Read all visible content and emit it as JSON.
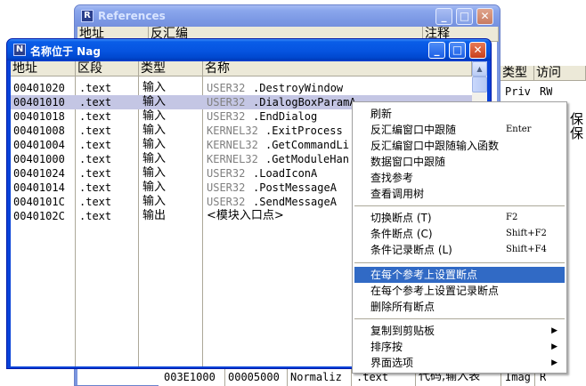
{
  "ref_window": {
    "title": "References",
    "icon_letter": "R",
    "header_partial": [
      "地址",
      "反汇编",
      "注释"
    ],
    "right_headers": [
      "类型",
      "访问"
    ],
    "right_rows": [
      [
        "Priv",
        "RW"
      ],
      [
        "Priv",
        "RW"
      ]
    ],
    "side_text": [
      "保",
      "保"
    ],
    "bottom_row": [
      "003E1000",
      "00005000",
      "Normaliz",
      ".text",
      "代码,输入表",
      "Imag",
      "R"
    ]
  },
  "nag_window": {
    "title": "名称位于 Nag",
    "icon_letter": "N",
    "columns": [
      "地址",
      "区段",
      "类型",
      "名称"
    ],
    "rows": [
      {
        "addr": "00401020",
        "section": ".text",
        "type": "输入",
        "module": "USER32",
        "func": ".DestroyWindow"
      },
      {
        "addr": "00401010",
        "section": ".text",
        "type": "输入",
        "module": "USER32",
        "func": ".DialogBoxParamA"
      },
      {
        "addr": "00401018",
        "section": ".text",
        "type": "输入",
        "module": "USER32",
        "func": ".EndDialog"
      },
      {
        "addr": "00401008",
        "section": ".text",
        "type": "输入",
        "module": "KERNEL32",
        "func": ".ExitProcess"
      },
      {
        "addr": "00401004",
        "section": ".text",
        "type": "输入",
        "module": "KERNEL32",
        "func": ".GetCommandLi"
      },
      {
        "addr": "00401000",
        "section": ".text",
        "type": "输入",
        "module": "KERNEL32",
        "func": ".GetModuleHan"
      },
      {
        "addr": "00401024",
        "section": ".text",
        "type": "输入",
        "module": "USER32",
        "func": ".LoadIconA"
      },
      {
        "addr": "00401014",
        "section": ".text",
        "type": "输入",
        "module": "USER32",
        "func": ".PostMessageA"
      },
      {
        "addr": "0040101C",
        "section": ".text",
        "type": "输入",
        "module": "USER32",
        "func": ".SendMessageA"
      },
      {
        "addr": "0040102C",
        "section": ".text",
        "type": "输出",
        "module": "",
        "func": "<模块入口点>"
      }
    ],
    "selected_index": 1
  },
  "context_menu": {
    "groups": [
      [
        {
          "label": "刷新",
          "shortcut": ""
        },
        {
          "label": "反汇编窗口中跟随",
          "shortcut": "Enter"
        },
        {
          "label": "反汇编窗口中跟随输入函数",
          "shortcut": ""
        },
        {
          "label": "数据窗口中跟随",
          "shortcut": ""
        },
        {
          "label": "查找参考",
          "shortcut": ""
        },
        {
          "label": "查看调用树",
          "shortcut": ""
        }
      ],
      [
        {
          "label": "切换断点 (T)",
          "shortcut": "F2"
        },
        {
          "label": "条件断点 (C)",
          "shortcut": "Shift+F2"
        },
        {
          "label": "条件记录断点 (L)",
          "shortcut": "Shift+F4"
        }
      ],
      [
        {
          "label": "在每个参考上设置断点",
          "shortcut": "",
          "highlighted": true
        },
        {
          "label": "在每个参考上设置记录断点",
          "shortcut": ""
        },
        {
          "label": "删除所有断点",
          "shortcut": ""
        }
      ],
      [
        {
          "label": "复制到剪贴板",
          "shortcut": "",
          "submenu": true
        },
        {
          "label": "排序按",
          "shortcut": "",
          "submenu": true
        },
        {
          "label": "界面选项",
          "shortcut": "",
          "submenu": true
        }
      ]
    ]
  }
}
